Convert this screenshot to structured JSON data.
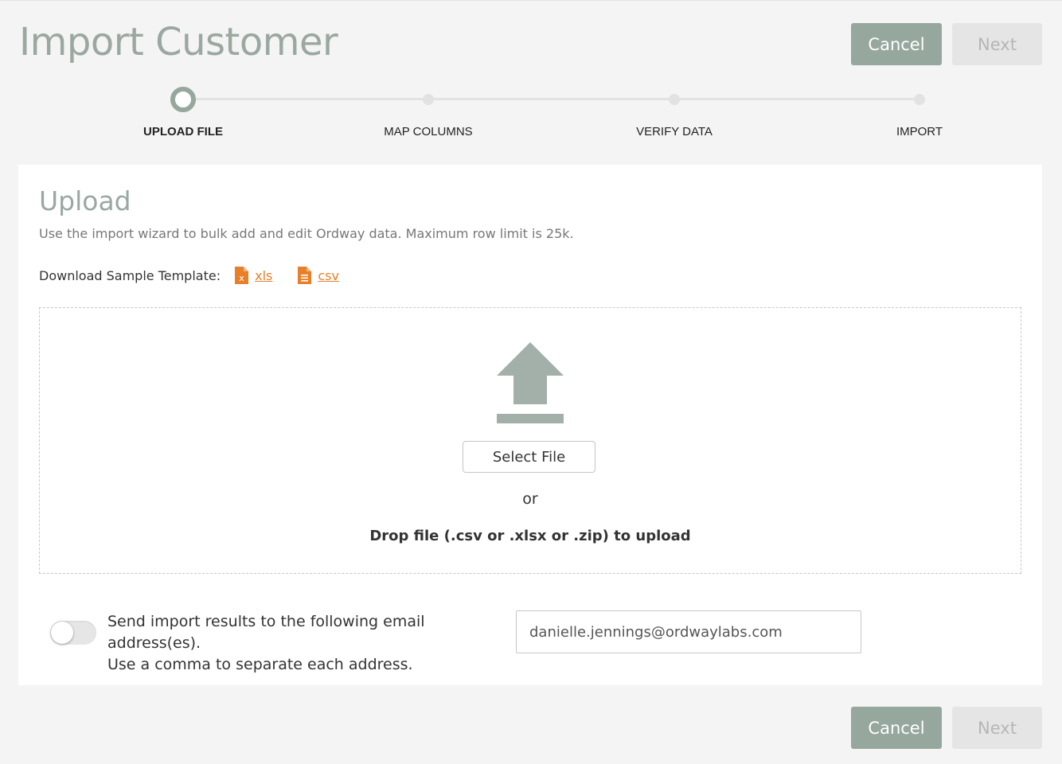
{
  "header": {
    "title": "Import Customer",
    "cancel_label": "Cancel",
    "next_label": "Next"
  },
  "stepper": {
    "steps": [
      {
        "label": "UPLOAD FILE",
        "active": true
      },
      {
        "label": "MAP COLUMNS",
        "active": false
      },
      {
        "label": "VERIFY DATA",
        "active": false
      },
      {
        "label": "IMPORT",
        "active": false
      }
    ]
  },
  "upload": {
    "title": "Upload",
    "description": "Use the import wizard to bulk add and edit Ordway data. Maximum row limit is 25k.",
    "template_label": "Download Sample Template:",
    "xls_label": "xls",
    "csv_label": "csv",
    "select_file_label": "Select File",
    "or_text": "or",
    "drop_text": "Drop file (.csv or .xlsx or .zip) to upload"
  },
  "email": {
    "toggle_on": false,
    "label_line1": "Send import results to the following email address(es).",
    "label_line2": "Use a comma to separate each address.",
    "value": "danielle.jennings@ordwaylabs.com"
  },
  "footer": {
    "cancel_label": "Cancel",
    "next_label": "Next"
  },
  "colors": {
    "accent": "#96a79e",
    "link": "#e8802a",
    "disabled": "#e5e5e5"
  },
  "icons": {
    "xls": "xls-file-icon",
    "csv": "csv-file-icon",
    "upload": "upload-arrow-icon"
  }
}
